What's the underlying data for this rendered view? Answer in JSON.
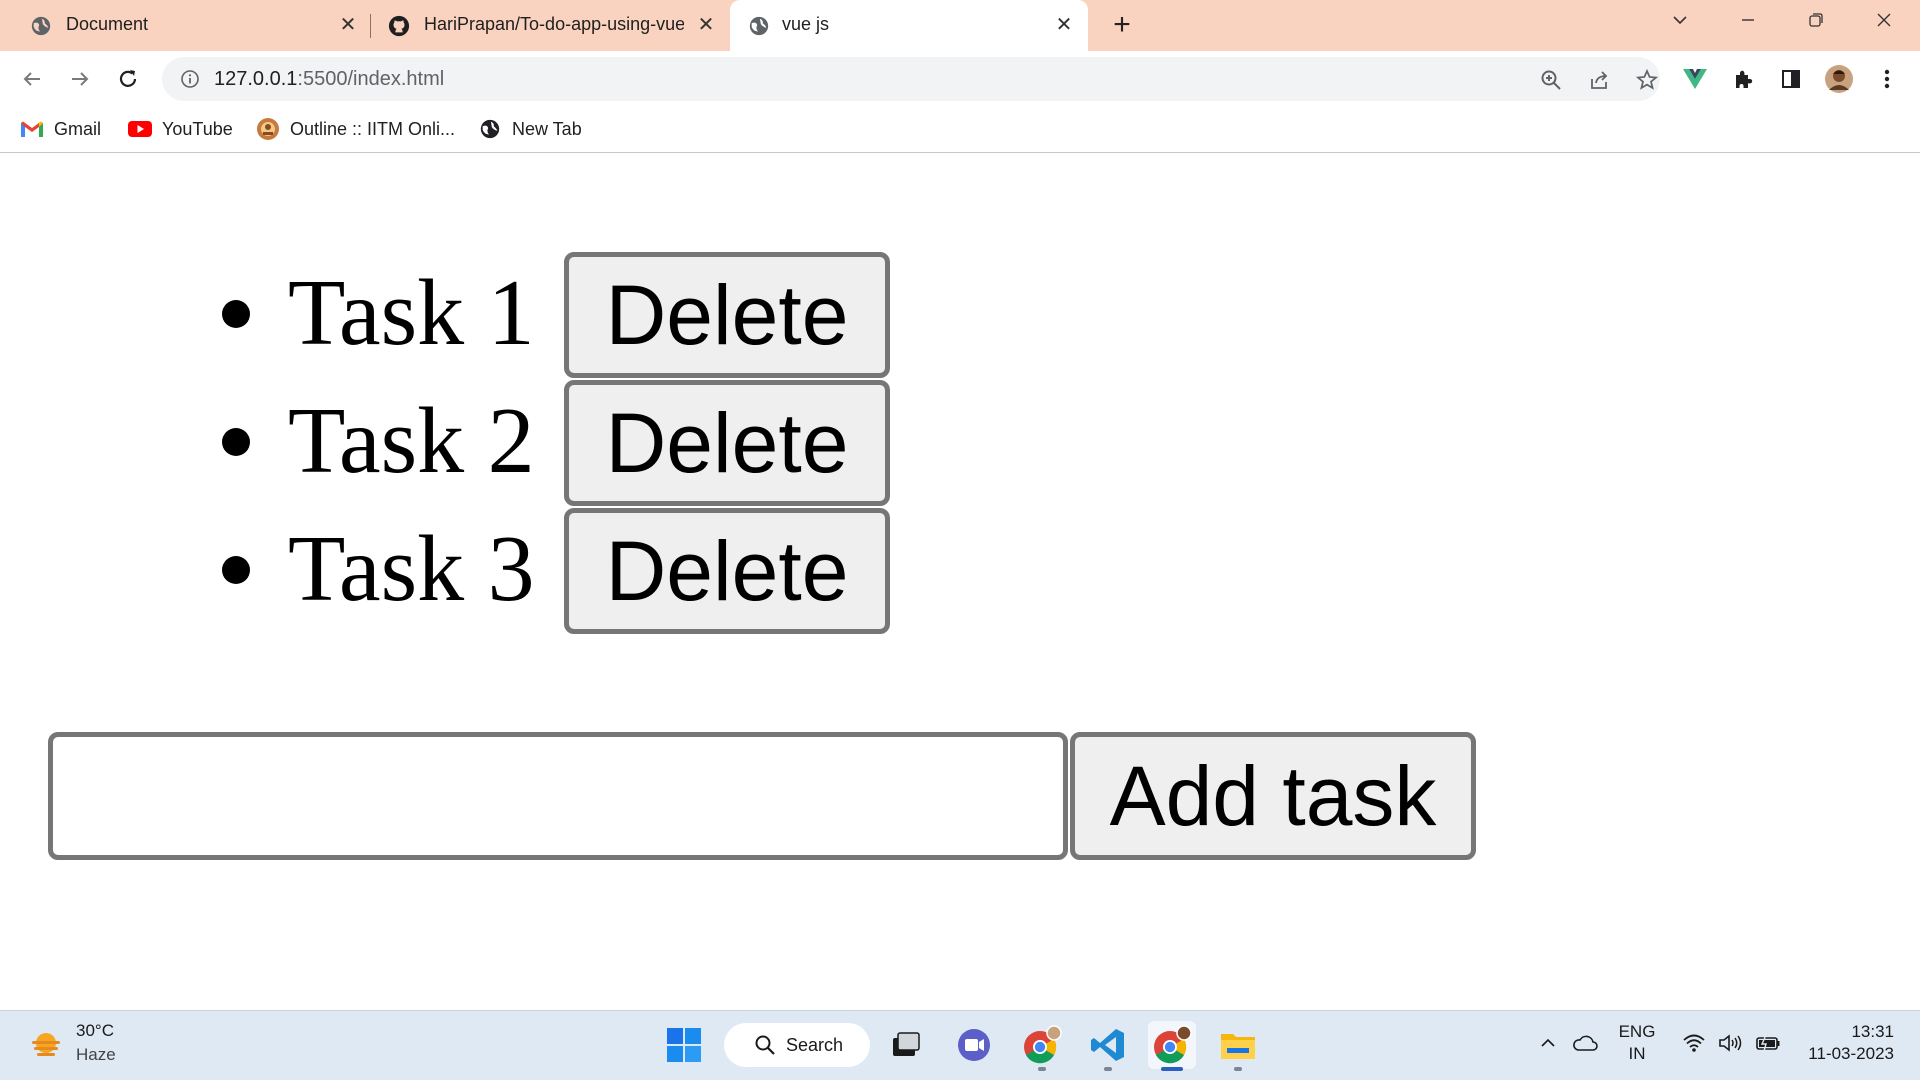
{
  "browser": {
    "tabs": [
      {
        "title": "Document",
        "favicon": "globe-icon",
        "active": false
      },
      {
        "title": "HariPrapan/To-do-app-using-vue",
        "favicon": "github-icon",
        "active": false
      },
      {
        "title": "vue js",
        "favicon": "globe-icon",
        "active": true
      }
    ],
    "address": {
      "host": "127.0.0.1",
      "path": ":5500/index.html"
    },
    "bookmarks": [
      {
        "label": "Gmail",
        "icon": "gmail-icon"
      },
      {
        "label": "YouTube",
        "icon": "youtube-icon"
      },
      {
        "label": "Outline :: IITM Onli...",
        "icon": "outline-icon"
      },
      {
        "label": "New Tab",
        "icon": "globe-icon"
      }
    ],
    "colors": {
      "tabstrip": "#f9d3bf",
      "omnibox": "#f1f3f4",
      "vue_green": "#41b883"
    }
  },
  "app": {
    "tasks": [
      {
        "label": "Task 1",
        "delete_label": "Delete"
      },
      {
        "label": "Task 2",
        "delete_label": "Delete"
      },
      {
        "label": "Task 3",
        "delete_label": "Delete"
      }
    ],
    "new_task": {
      "value": "",
      "placeholder": ""
    },
    "add_label": "Add task"
  },
  "taskbar": {
    "weather": {
      "temp": "30°C",
      "desc": "Haze"
    },
    "search_label": "Search",
    "lang": {
      "line1": "ENG",
      "line2": "IN"
    },
    "clock": {
      "time": "13:31",
      "date": "11-03-2023"
    }
  }
}
